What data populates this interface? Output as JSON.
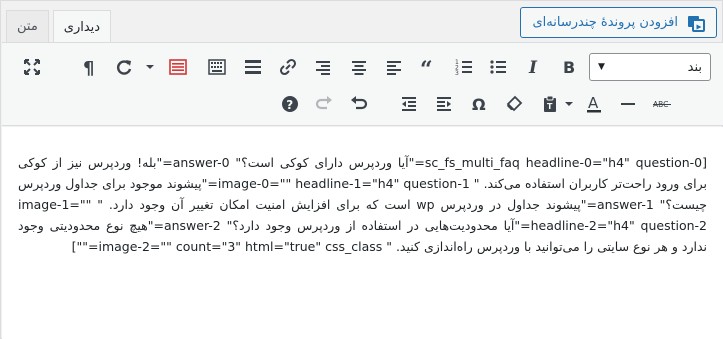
{
  "header": {
    "add_media_label": "افزودن پروندهٔ چندرسانه‌ای",
    "tabs": [
      {
        "label": "دیداری",
        "active": true
      },
      {
        "label": "متن",
        "active": false
      }
    ]
  },
  "toolbar": {
    "format_select_value": "بند",
    "row1_icons": [
      "bold-icon",
      "italic-icon",
      "bullet-list-icon",
      "numbered-list-icon",
      "blockquote-icon",
      "align-left-icon",
      "align-center-icon",
      "align-right-icon",
      "link-icon",
      "read-more-icon",
      "toolbar-toggle-icon",
      "fullscreen-caret-icon",
      "paragraph-mark-icon",
      "fullscreen-icon"
    ],
    "row2_icons": [
      "strikethrough-icon",
      "horizontal-line-icon",
      "text-color-icon",
      "paste-as-text-icon",
      "clear-formatting-icon",
      "special-character-icon",
      "indent-icon",
      "outdent-icon",
      "undo-icon",
      "redo-icon",
      "help-icon"
    ]
  },
  "editor": {
    "content": "[sc_fs_multi_faq headline-0=\"h4\" question-0=\"آیا وردپرس دارای کوکی است؟\" answer-0=\"بله! وردپرس نیز از کوکی برای ورود راحت‌تر کاربران استفاده می‌کند. \" image-0=\"\" headline-1=\"h4\" question-1=\"پیشوند موجود برای جداول وردپرس چیست؟\" answer-1=\"پیشوند جداول در وردپرس wp است که برای افزایش امنیت امکان تغییر آن وجود دارد. \" image-1=\"\" headline-2=\"h4\" question-2=\"آیا محدودیت‌هایی در استفاده از وردپرس وجود دارد؟\" answer-2=\"هیچ نوع محدودیتی وجود ندارد و هر نوع سایتی را می‌توانید با وردپرس راه‌اندازی کنید. \" image-2=\"\" count=\"3\" html=\"true\" css_class=\"\"]"
  }
}
